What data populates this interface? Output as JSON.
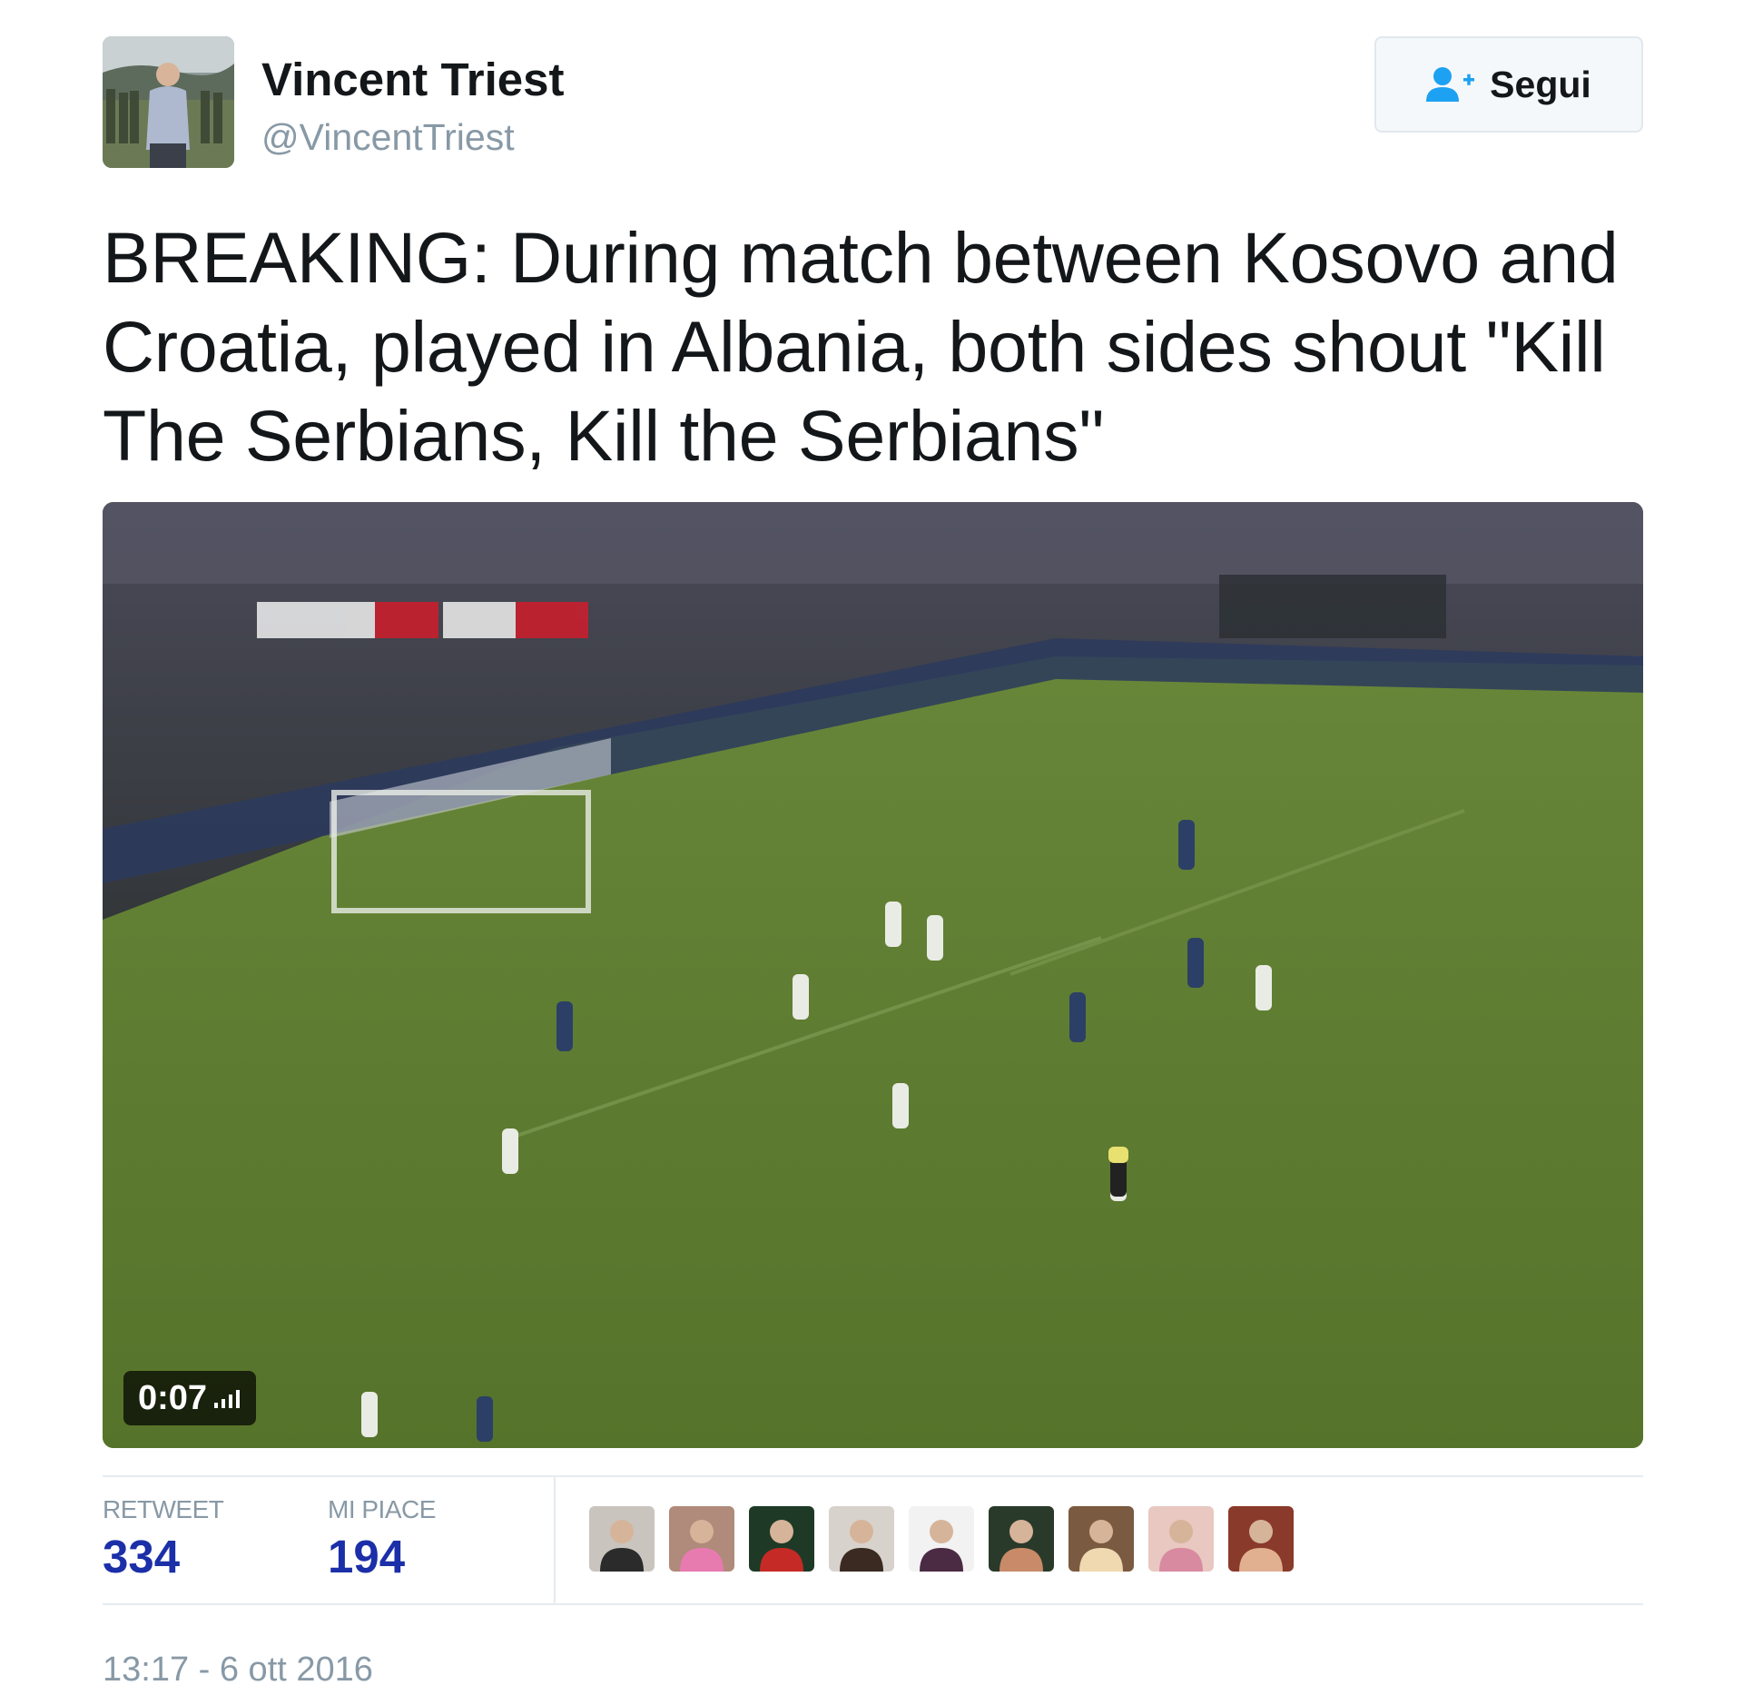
{
  "user": {
    "name": "Vincent Triest",
    "handle": "@VincentTriest",
    "avatar_icon": "user-avatar-photo"
  },
  "follow_button": {
    "label": "Segui",
    "icon": "add-user-icon",
    "icon_color": "#1da1f2"
  },
  "tweet": {
    "text": "BREAKING: During match between Kosovo and Croatia, played in Albania, both sides shout \"Kill The Serbians, Kill the Serbians\""
  },
  "video": {
    "duration": "0:07",
    "signal_icon": "volume-bars-icon"
  },
  "stats": {
    "retweet_label": "RETWEET",
    "retweet_count": "334",
    "likes_label": "MI PIACE",
    "likes_count": "194",
    "value_color": "#1b2fa8"
  },
  "likers": [
    {
      "icon": "liker-avatar-1",
      "bg": "#c9c4bd",
      "fg": "#2b2b2b"
    },
    {
      "icon": "liker-avatar-2",
      "bg": "#b08a7a",
      "fg": "#e77bb0"
    },
    {
      "icon": "liker-avatar-3",
      "bg": "#1e3a26",
      "fg": "#c62a26"
    },
    {
      "icon": "liker-avatar-4",
      "bg": "#d8d2cc",
      "fg": "#3a2a22"
    },
    {
      "icon": "liker-avatar-5",
      "bg": "#f2f2f2",
      "fg": "#4b2a44"
    },
    {
      "icon": "liker-avatar-6",
      "bg": "#2a3a2a",
      "fg": "#c98a6a"
    },
    {
      "icon": "liker-avatar-7",
      "bg": "#7a5a40",
      "fg": "#f0d8b0"
    },
    {
      "icon": "liker-avatar-8",
      "bg": "#e8c8c0",
      "fg": "#d88aa0"
    },
    {
      "icon": "liker-avatar-9",
      "bg": "#8a3a2a",
      "fg": "#e0b090"
    }
  ],
  "timestamp": "13:17 - 6 ott 2016"
}
